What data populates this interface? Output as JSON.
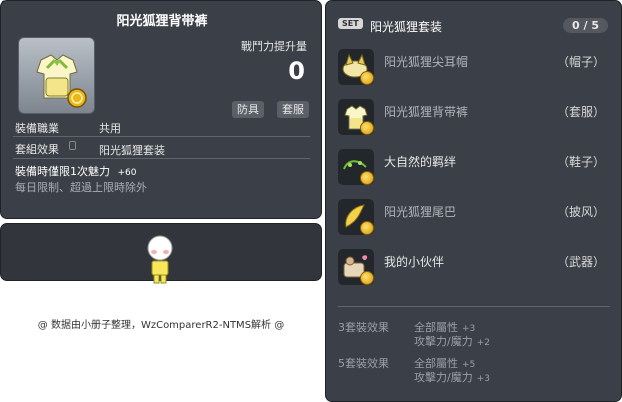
{
  "item": {
    "id": "01053574",
    "name": "阳光狐狸背带裤",
    "power_label": "戰鬥力提升量",
    "power_value": "0",
    "tags": [
      "防具",
      "套服"
    ],
    "job_label": "裝備職業",
    "job_value": "共用",
    "set_label": "套組效果",
    "set_value": "阳光狐狸套装",
    "equip_bonus": "裝備時僅限1次魅力",
    "equip_bonus_value": "+60",
    "limit_note": "每日限制、超過上限時除外"
  },
  "set": {
    "badge": "SET",
    "title": "阳光狐狸套装",
    "count": "0 / 5",
    "items": [
      {
        "name": "阳光狐狸尖耳帽",
        "category": "（帽子）",
        "icon": "fox-ear-hat-icon"
      },
      {
        "name": "阳光狐狸背带裤",
        "category": "（套服）",
        "icon": "overalls-icon"
      },
      {
        "name": "大自然的羁绊",
        "category": "（鞋子）",
        "icon": "nature-bond-icon"
      },
      {
        "name": "阳光狐狸尾巴",
        "category": "（披风）",
        "icon": "fox-tail-icon"
      },
      {
        "name": "我的小伙伴",
        "category": "（武器）",
        "icon": "buddy-weapon-icon"
      }
    ],
    "effects": [
      {
        "count": "3套裝效果",
        "lines": [
          {
            "text": "全部屬性",
            "value": "+3"
          },
          {
            "text": "攻擊力/魔力",
            "value": "+2"
          }
        ]
      },
      {
        "count": "5套裝效果",
        "lines": [
          {
            "text": "全部屬性",
            "value": "+5"
          },
          {
            "text": "攻擊力/魔力",
            "value": "+3"
          }
        ]
      }
    ]
  },
  "footer": "@ 数据由小册子整理，WzComparerR2-NTMS解析 @"
}
